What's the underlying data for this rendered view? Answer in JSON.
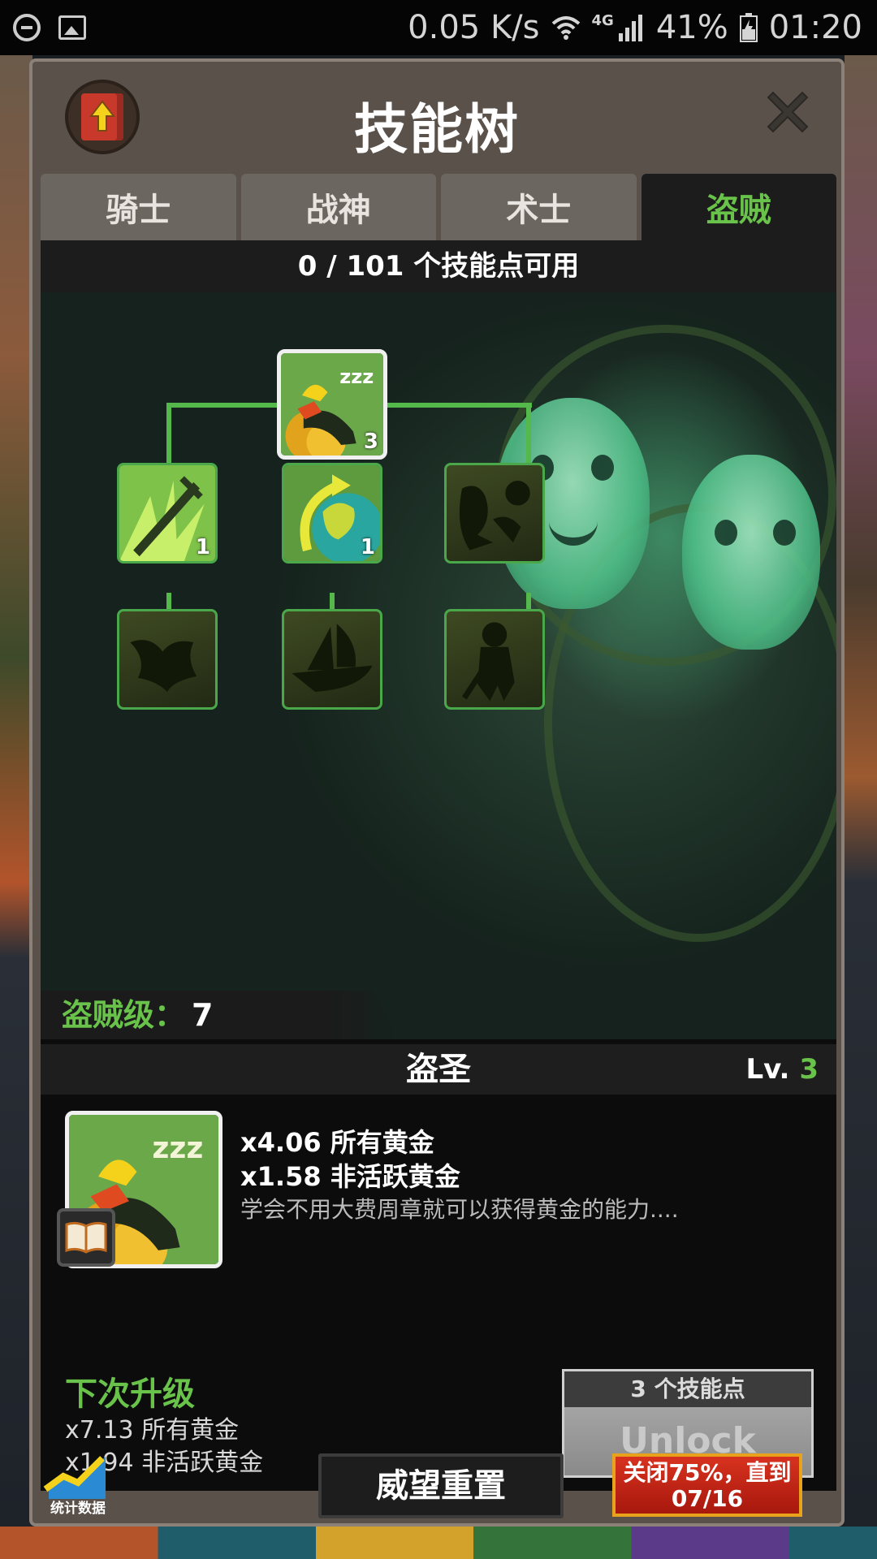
{
  "status_bar": {
    "speed": "0.05 K/s",
    "network": "4G",
    "battery": "41%",
    "time": "01:20"
  },
  "panel": {
    "title": "技能树",
    "tabs": [
      {
        "label": "骑士",
        "active": false
      },
      {
        "label": "战神",
        "active": false
      },
      {
        "label": "术士",
        "active": false
      },
      {
        "label": "盗贼",
        "active": true
      }
    ],
    "points_available": "0 / 101 个技能点可用"
  },
  "tree": {
    "nodes": [
      {
        "name": "盗圣",
        "level": "3",
        "state": "selected"
      },
      {
        "name": "blade-skill",
        "level": "1",
        "state": "unlocked"
      },
      {
        "name": "globe-skill",
        "level": "1",
        "state": "unlocked"
      },
      {
        "name": "shadow-beast",
        "level": "",
        "state": "locked"
      },
      {
        "name": "shadow-bird",
        "level": "",
        "state": "locked"
      },
      {
        "name": "shadow-ship",
        "level": "",
        "state": "locked"
      },
      {
        "name": "shadow-warrior",
        "level": "",
        "state": "locked"
      }
    ],
    "class_level_label": "盗贼级：",
    "class_level_value": "7"
  },
  "skill_detail": {
    "name": "盗圣",
    "lv_label": "Lv.",
    "lv_value": "3",
    "stats": [
      "x4.06 所有黄金",
      "x1.58 非活跃黄金"
    ],
    "description": "学会不用大费周章就可以获得黄金的能力....",
    "next_title": "下次升级",
    "next_stats": [
      "x7.13 所有黄金",
      "x1.94 非活跃黄金"
    ],
    "unlock_cost": "3 个技能点",
    "unlock_label": "Unlock"
  },
  "footer": {
    "stats_label": "统计数据",
    "prestige_label": "威望重置",
    "sale_line1": "关闭75%，直到",
    "sale_line2": "07/16"
  },
  "colors": {
    "accent_green": "#69c24a",
    "panel_bg": "#5a514a",
    "sale_red": "#c4261a"
  }
}
